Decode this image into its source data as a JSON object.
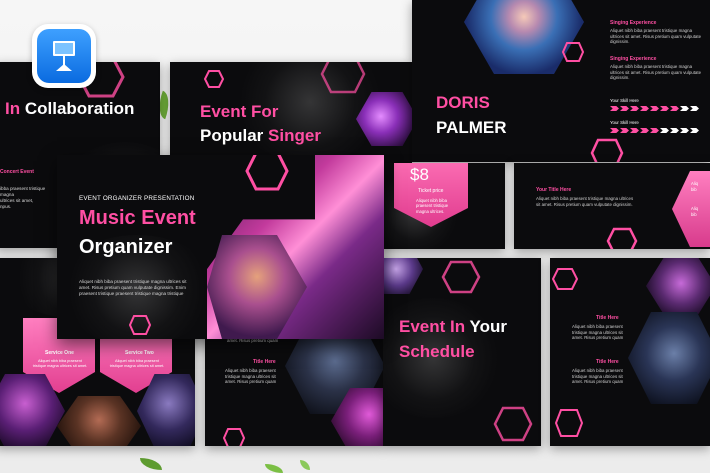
{
  "app_icon": {
    "name": "keynote-icon",
    "bg": "#1f7bf0"
  },
  "colors": {
    "accent": "#ff4fa3",
    "bg": "#0b0b0d"
  },
  "slide_collab": {
    "title_accent": "In",
    "title_rest": "Collaboration",
    "sub_title": "Concert Event",
    "body": "ibba praesent tristique\nmagna\nultrices sit amet,\nnpus."
  },
  "slide_singer": {
    "line1": "Event For",
    "line2_white": "Popular",
    "line2_accent": "Singer"
  },
  "slide_doris": {
    "first": "DORIS",
    "last": "PALMER",
    "exp1_title": "Singing Experience",
    "exp1_body": "Aliquet nibh biba praesent tristique magna ultrices sit amet. Risus pretium quam vulputate dignissim.",
    "exp2_title": "Singing Experience",
    "exp2_body": "Aliquet nibh biba praesent tristique magna ultrices sit amet. Risus pretium quam vulputate dignissim.",
    "skill1": "Your Skill Here",
    "skill2": "Your Skill Here"
  },
  "slide_price": {
    "price": "$8",
    "label": "Ticket price",
    "body": "Aliquet nibh biba\npraesent tristique\nmagna ultrices."
  },
  "slide_title_here": {
    "title": "Your Title Here",
    "body": "Aliquet nibh biba praesent tristique magna ultrices sit amet. Risus pretium quam vulputate dignissim.",
    "bullets": [
      "Aliq",
      "bib",
      "Aliq",
      "bib"
    ]
  },
  "slide_main": {
    "kicker": "EVENT ORGANIZER PRESENTATION",
    "title1": "Music Event",
    "title2": "Organizer",
    "body": "Aliquet nibh biba praesent tristique magna ultrices sit amet. Risus pretium quam vulputate dignissim. Enim praesent tristique praesent tristique magna tristique"
  },
  "slide_services": {
    "one_title": "Service One",
    "one_body": "Aliquet nibh biba praesent tristique magna ultrices sit amet.",
    "two_title": "Service Two",
    "two_body": "Aliquet nibh biba praesent tristique magna ultrices sit amet."
  },
  "slide_center_bottom": {
    "caption": "amet. Risus pretium quam",
    "title": "Title Here",
    "body": "Aliquet nibh biba praesent\ntristique magna ultrices sit\namet. Risus pretium quam"
  },
  "slide_schedule": {
    "line1_accent": "Event In",
    "line1_white": "Your",
    "line2_accent": "Schedule"
  },
  "slide_titles": {
    "t1": "Title Here",
    "b1": "Aliquet nibh biba praesent\ntristique magna ultrices sit\namet. Risus pretium quam",
    "t2": "Title Here",
    "b2": "Aliquet nibh biba praesent\ntristique magna ultrices sit\namet. Risus pretium quam"
  }
}
